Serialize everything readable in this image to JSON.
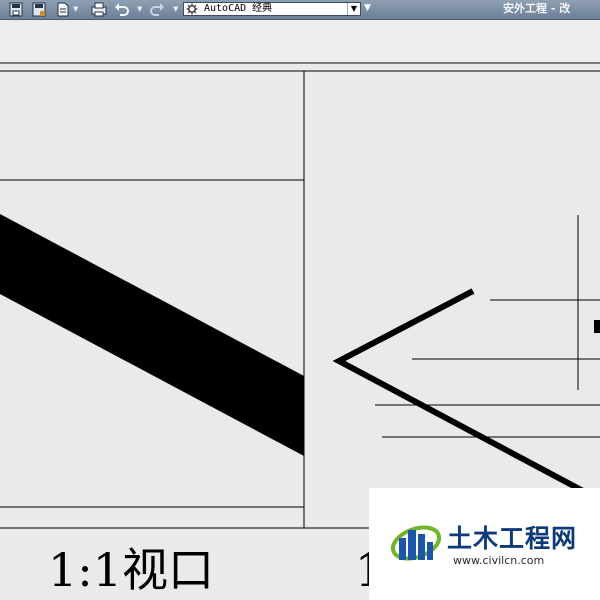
{
  "quick_access_toolbar": {
    "buttons": [
      {
        "name": "save-icon"
      },
      {
        "name": "save-as-icon"
      },
      {
        "name": "plot-icon"
      },
      {
        "name": "print-icon"
      },
      {
        "name": "undo-icon"
      },
      {
        "name": "redo-icon"
      }
    ],
    "workspace": {
      "value": "AutoCAD 经典"
    },
    "window_title": "安外工程 - 改"
  },
  "viewport_captions": {
    "left": "1:1视口",
    "right": "1"
  },
  "watermark": {
    "name": "土木工程网",
    "url": "www.civilcn.com"
  },
  "colors": {
    "toolbar": "#7b8ca3",
    "canvas": "#e9ebea",
    "ink": "#000000",
    "watermark_brand": "#0d3a7a"
  }
}
